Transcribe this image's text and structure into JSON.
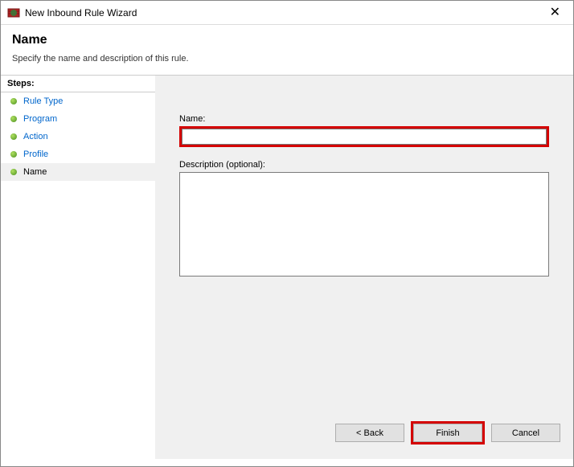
{
  "window": {
    "title": "New Inbound Rule Wizard"
  },
  "header": {
    "title": "Name",
    "subtitle": "Specify the name and description of this rule."
  },
  "sidebar": {
    "title": "Steps:",
    "items": [
      {
        "label": "Rule Type"
      },
      {
        "label": "Program"
      },
      {
        "label": "Action"
      },
      {
        "label": "Profile"
      },
      {
        "label": "Name"
      }
    ]
  },
  "form": {
    "name_label": "Name:",
    "name_value": "",
    "desc_label": "Description (optional):",
    "desc_value": ""
  },
  "buttons": {
    "back": "< Back",
    "finish": "Finish",
    "cancel": "Cancel"
  }
}
